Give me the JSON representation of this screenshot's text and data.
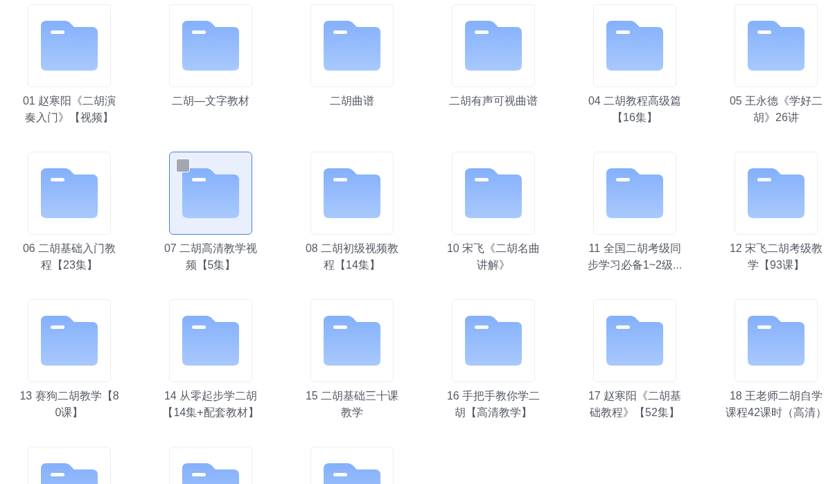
{
  "folders": [
    {
      "name": "01 赵寒阳《二胡演奏入门》【视频】",
      "selected": false
    },
    {
      "name": "二胡—文字教材",
      "selected": false
    },
    {
      "name": "二胡曲谱",
      "selected": false
    },
    {
      "name": "二胡有声可视曲谱",
      "selected": false
    },
    {
      "name": "04 二胡教程高级篇【16集】",
      "selected": false
    },
    {
      "name": "05 王永德《学好二胡》26讲",
      "selected": false
    },
    {
      "name": "06 二胡基础入门教程【23集】",
      "selected": false
    },
    {
      "name": "07 二胡高清教学视频【5集】",
      "selected": true
    },
    {
      "name": "08 二胡初级视频教程【14集】",
      "selected": false
    },
    {
      "name": "10 宋飞《二胡名曲讲解》",
      "selected": false
    },
    {
      "name": "11 全国二胡考级同步学习必备1~2级...",
      "selected": false
    },
    {
      "name": "12 宋飞二胡考级教学【93课】",
      "selected": false
    },
    {
      "name": "13 赛狗二胡教学【80课】",
      "selected": false
    },
    {
      "name": "14 从零起步学二胡【14集+配套教材】",
      "selected": false
    },
    {
      "name": "15 二胡基础三十课教学",
      "selected": false
    },
    {
      "name": "16 手把手教你学二胡【高清教学】",
      "selected": false
    },
    {
      "name": "17 赵寒阳《二胡基础教程》【52集】",
      "selected": false
    },
    {
      "name": "18 王老师二胡自学课程42课时（高清）",
      "selected": false
    },
    {
      "selected": false
    },
    {
      "selected": false
    },
    {
      "selected": false
    }
  ]
}
